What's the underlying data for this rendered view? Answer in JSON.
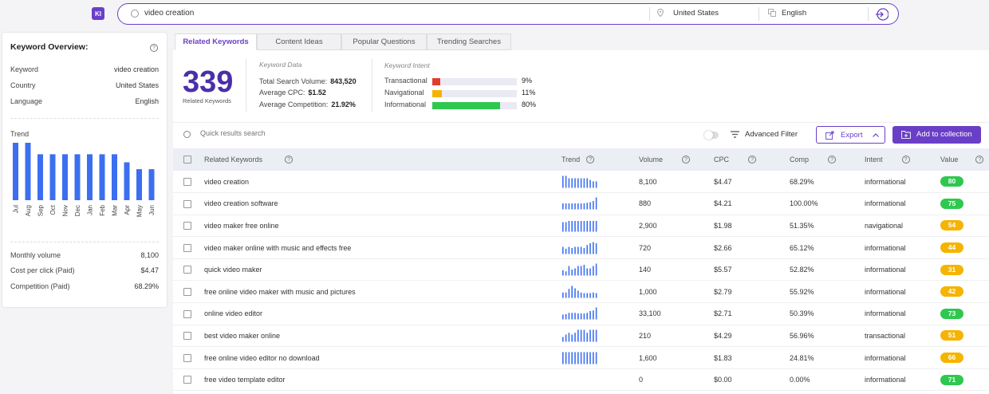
{
  "app": {
    "logo": "KI"
  },
  "search": {
    "query": "video creation",
    "location": "United States",
    "language": "English"
  },
  "overview": {
    "title": "Keyword Overview:",
    "rows": [
      {
        "label": "Keyword",
        "value": "video creation"
      },
      {
        "label": "Country",
        "value": "United States"
      },
      {
        "label": "Language",
        "value": "English"
      }
    ],
    "trend_label": "Trend",
    "stats": [
      {
        "label": "Monthly volume",
        "value": "8,100"
      },
      {
        "label": "Cost per click (Paid)",
        "value": "$4.47"
      },
      {
        "label": "Competition (Paid)",
        "value": "68.29%"
      }
    ]
  },
  "chart_data": {
    "type": "bar",
    "categories": [
      "Jul",
      "Aug",
      "Sep",
      "Oct",
      "Nov",
      "Dec",
      "Jan",
      "Feb",
      "Mar",
      "Apr",
      "May",
      "Jun"
    ],
    "values": [
      100,
      100,
      80,
      80,
      80,
      80,
      80,
      80,
      80,
      66,
      54,
      54
    ],
    "ylim": [
      0,
      100
    ],
    "color": "#3c6ff0"
  },
  "tabs": [
    "Related Keywords",
    "Content Ideas",
    "Popular Questions",
    "Trending Searches"
  ],
  "summary": {
    "count": "339",
    "count_label": "Related Keywords",
    "data_title": "Keyword Data",
    "data": [
      {
        "label": "Total Search Volume:",
        "value": "843,520"
      },
      {
        "label": "Average CPC:",
        "value": "$1.52"
      },
      {
        "label": "Average Competition:",
        "value": "21.92%"
      }
    ],
    "intent_title": "Keyword Intent",
    "intent": [
      {
        "label": "Transactional",
        "value": "9%",
        "fraction": 0.09,
        "color": "#e03c31"
      },
      {
        "label": "Navigational",
        "value": "11%",
        "fraction": 0.11,
        "color": "#f5b400"
      },
      {
        "label": "Informational",
        "value": "80%",
        "fraction": 0.8,
        "color": "#2fc84f"
      }
    ]
  },
  "toolbar": {
    "search_placeholder": "Quick results search",
    "filter_label": "Advanced Filter",
    "export_label": "Export",
    "add_label": "Add to collection"
  },
  "table": {
    "headers": {
      "keyword": "Related Keywords",
      "trend": "Trend",
      "volume": "Volume",
      "cpc": "CPC",
      "comp": "Comp",
      "intent": "Intent",
      "value": "Value"
    },
    "rows": [
      {
        "keyword": "video creation",
        "volume": "8,100",
        "cpc": "$4.47",
        "comp": "68.29%",
        "intent": "informational",
        "value": "80",
        "value_color": "#2fc84f",
        "trend": [
          100,
          100,
          80,
          80,
          80,
          80,
          80,
          80,
          80,
          66,
          54,
          54
        ]
      },
      {
        "keyword": "video creation software",
        "volume": "880",
        "cpc": "$4.21",
        "comp": "100.00%",
        "intent": "informational",
        "value": "75",
        "value_color": "#2fc84f",
        "trend": [
          50,
          50,
          50,
          50,
          50,
          50,
          50,
          50,
          55,
          60,
          70,
          100
        ]
      },
      {
        "keyword": "video maker free online",
        "volume": "2,900",
        "cpc": "$1.98",
        "comp": "51.35%",
        "intent": "navigational",
        "value": "54",
        "value_color": "#f5b400",
        "trend": [
          80,
          80,
          90,
          90,
          90,
          90,
          90,
          90,
          90,
          90,
          90,
          90
        ]
      },
      {
        "keyword": "video maker online with music and effects free",
        "volume": "720",
        "cpc": "$2.66",
        "comp": "65.12%",
        "intent": "informational",
        "value": "44",
        "value_color": "#f5b400",
        "trend": [
          60,
          45,
          60,
          50,
          60,
          60,
          60,
          50,
          75,
          90,
          100,
          90
        ]
      },
      {
        "keyword": "quick video maker",
        "volume": "140",
        "cpc": "$5.57",
        "comp": "52.82%",
        "intent": "informational",
        "value": "31",
        "value_color": "#f5b400",
        "trend": [
          45,
          35,
          80,
          50,
          60,
          80,
          80,
          90,
          60,
          60,
          80,
          100
        ]
      },
      {
        "keyword": "free online video maker with music and pictures",
        "volume": "1,000",
        "cpc": "$2.79",
        "comp": "55.92%",
        "intent": "informational",
        "value": "42",
        "value_color": "#f5b400",
        "trend": [
          45,
          45,
          75,
          100,
          80,
          60,
          45,
          40,
          40,
          40,
          45,
          40
        ]
      },
      {
        "keyword": "online video editor",
        "volume": "33,100",
        "cpc": "$2.71",
        "comp": "50.39%",
        "intent": "informational",
        "value": "73",
        "value_color": "#2fc84f",
        "trend": [
          40,
          45,
          55,
          55,
          55,
          50,
          50,
          50,
          55,
          70,
          75,
          100
        ]
      },
      {
        "keyword": "best video maker online",
        "volume": "210",
        "cpc": "$4.29",
        "comp": "56.96%",
        "intent": "transactional",
        "value": "51",
        "value_color": "#f5b400",
        "trend": [
          40,
          60,
          75,
          60,
          75,
          100,
          100,
          100,
          75,
          100,
          100,
          100
        ]
      },
      {
        "keyword": "free online video editor no download",
        "volume": "1,600",
        "cpc": "$1.83",
        "comp": "24.81%",
        "intent": "informational",
        "value": "66",
        "value_color": "#f5b400",
        "trend": [
          100,
          100,
          100,
          100,
          100,
          100,
          100,
          100,
          100,
          100,
          100,
          100
        ]
      },
      {
        "keyword": "free video template editor",
        "volume": "0",
        "cpc": "$0.00",
        "comp": "0.00%",
        "intent": "informational",
        "value": "71",
        "value_color": "#2fc84f",
        "trend": []
      }
    ]
  }
}
